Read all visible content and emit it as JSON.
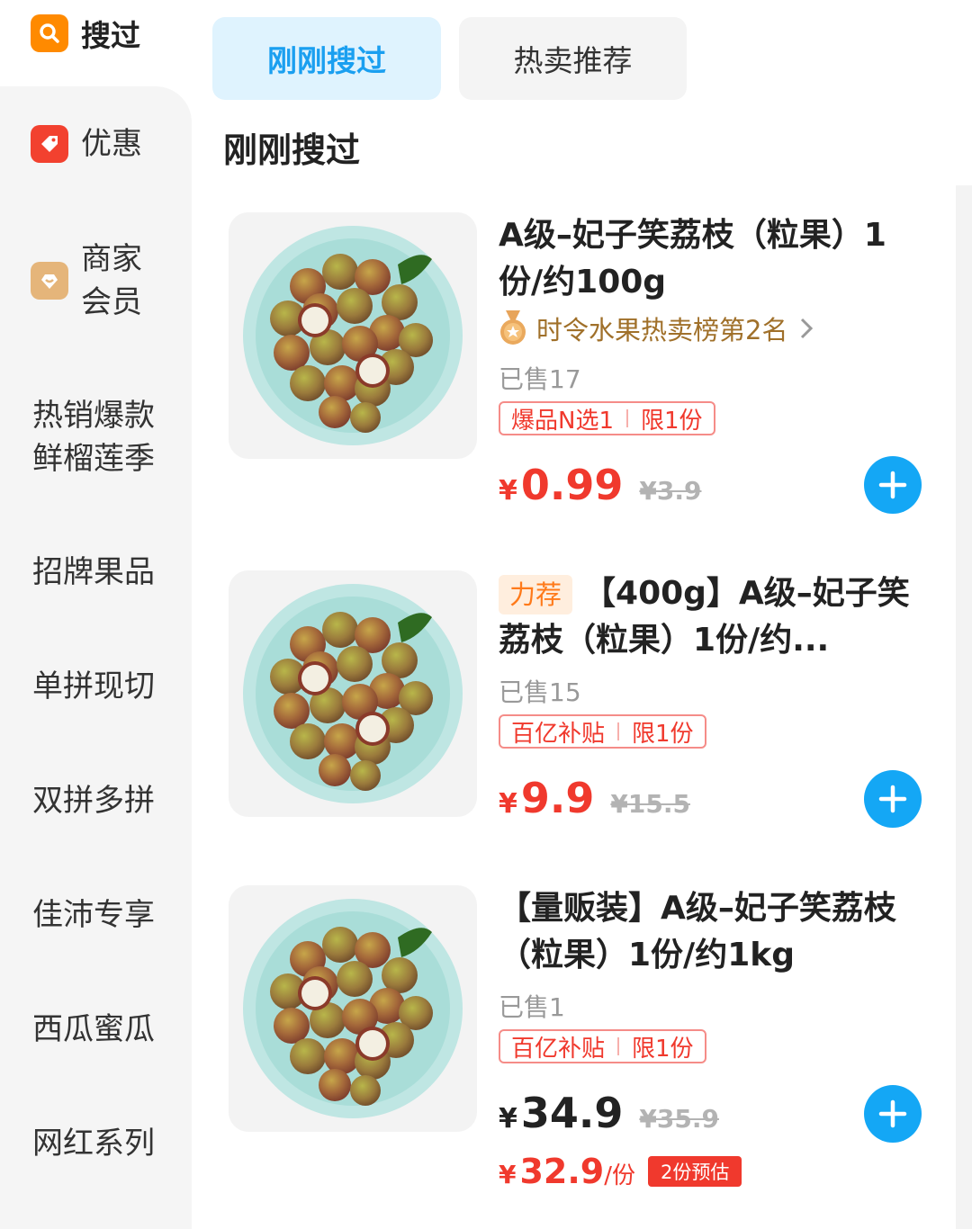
{
  "sidebar": {
    "search": {
      "label": "搜过"
    },
    "items": [
      {
        "label": "优惠"
      },
      {
        "label_line1": "商家",
        "label_line2": "会员"
      },
      {
        "label_line1": "热销爆款",
        "label_line2": "鲜榴莲季"
      },
      {
        "label": "招牌果品"
      },
      {
        "label": "单拼现切"
      },
      {
        "label": "双拼多拼"
      },
      {
        "label": "佳沛专享"
      },
      {
        "label": "西瓜蜜瓜"
      },
      {
        "label": "网红系列"
      }
    ]
  },
  "tabs": [
    {
      "label": "刚刚搜过",
      "active": true
    },
    {
      "label": "热卖推荐",
      "active": false
    }
  ],
  "section_title": "刚刚搜过",
  "products": [
    {
      "title": "A级–妃子笑荔枝（粒果）1份/约100g",
      "rank": "时令水果热卖榜第2名",
      "sold": "已售17",
      "promo_a": "爆品N选1",
      "promo_b": "限1份",
      "yen": "¥",
      "price": "0.99",
      "orig_price": "¥3.9"
    },
    {
      "tag": "力荐",
      "title": "【400g】A级–妃子笑荔枝（粒果）1份/约...",
      "sold": "已售15",
      "promo_a": "百亿补贴",
      "promo_b": "限1份",
      "yen": "¥",
      "price": "9.9",
      "orig_price": "¥15.5"
    },
    {
      "title": "【量贩装】A级–妃子笑荔枝（粒果）1份/约1kg",
      "sold": "已售1",
      "promo_a": "百亿补贴",
      "promo_b": "限1份",
      "yen": "¥",
      "price": "34.9",
      "orig_price": "¥35.9",
      "est_price": "32.9",
      "est_unit": "/份",
      "est_badge": "2份预估"
    }
  ],
  "colors": {
    "accent_blue": "#14a7f5",
    "price_red": "#f0392d",
    "search_orange": "#ff8a00"
  }
}
